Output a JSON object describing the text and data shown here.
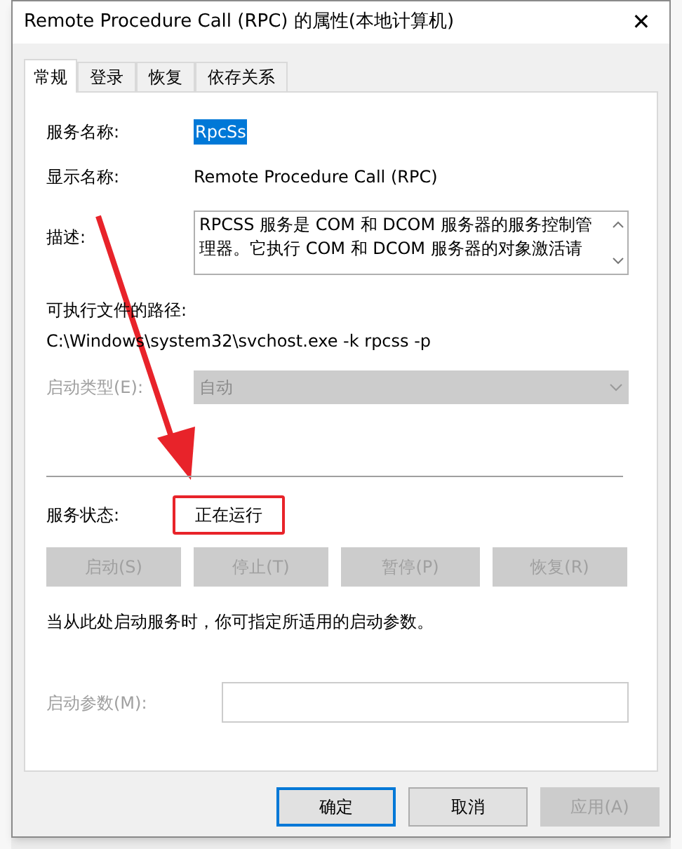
{
  "window": {
    "title": "Remote Procedure Call (RPC) 的属性(本地计算机)",
    "close": "✕"
  },
  "tabs": [
    {
      "label": "常规",
      "selected": true
    },
    {
      "label": "登录",
      "selected": false
    },
    {
      "label": "恢复",
      "selected": false
    },
    {
      "label": "依存关系",
      "selected": false
    }
  ],
  "service_name": {
    "label": "服务名称:",
    "value": "RpcSs",
    "selected": true
  },
  "display_name": {
    "label": "显示名称:",
    "value": "Remote Procedure Call (RPC)"
  },
  "description": {
    "label": "描述:",
    "value": "RPCSS 服务是 COM 和 DCOM 服务器的服务控制管理器。它执行 COM 和 DCOM 服务器的对象激活请"
  },
  "executable_path": {
    "label": "可执行文件的路径:",
    "value": "C:\\Windows\\system32\\svchost.exe -k rpcss -p"
  },
  "startup_type": {
    "label": "启动类型(E):",
    "value": "自动",
    "disabled": true
  },
  "service_status": {
    "label": "服务状态:",
    "value": "正在运行",
    "highlighted": true
  },
  "service_buttons": [
    {
      "label": "启动(S)",
      "disabled": true
    },
    {
      "label": "停止(T)",
      "disabled": true
    },
    {
      "label": "暂停(P)",
      "disabled": true
    },
    {
      "label": "恢复(R)",
      "disabled": true
    }
  ],
  "hint": "当从此处启动服务时，你可指定所适用的启动参数。",
  "start_parameters": {
    "label": "启动参数(M):",
    "disabled": true
  },
  "dialog_buttons": [
    {
      "label": "确定",
      "default": true,
      "disabled": false
    },
    {
      "label": "取消",
      "default": false,
      "disabled": false
    },
    {
      "label": "应用(A)",
      "default": false,
      "disabled": true
    }
  ],
  "annotation_arrow": true
}
